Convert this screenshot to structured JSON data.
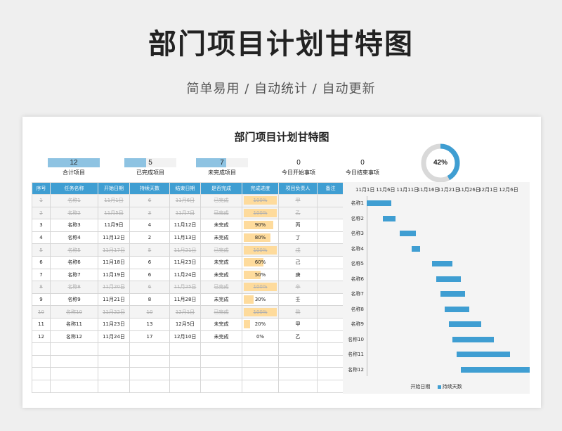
{
  "hero": {
    "title": "部门项目计划甘特图",
    "subtitle": "简单易用  /  自动统计  /  自动更新"
  },
  "sheet": {
    "title": "部门项目计划甘特图"
  },
  "stats": [
    {
      "value": "12",
      "label": "合计项目",
      "fill": 1.0
    },
    {
      "value": "5",
      "label": "已完成项目",
      "fill": 0.42
    },
    {
      "value": "7",
      "label": "未完成项目",
      "fill": 0.58
    },
    {
      "value": "0",
      "label": "今日开始事项",
      "fill": 0
    },
    {
      "value": "0",
      "label": "今日结束事项",
      "fill": 0
    }
  ],
  "donut": {
    "percent": "42%",
    "fraction": 0.42,
    "color": "#3f9ed2",
    "track": "#d9d9d9"
  },
  "table": {
    "headers": [
      "序号",
      "任务名称",
      "开始日期",
      "持续天数",
      "结束日期",
      "是否完成",
      "完成进度",
      "项目负责人",
      "备注"
    ],
    "rows": [
      {
        "no": "1",
        "name": "名称1",
        "start": "11月1日",
        "days": "6",
        "end": "11月6日",
        "status": "已完成",
        "progress": "100%",
        "p": 1.0,
        "owner": "甲",
        "done": true
      },
      {
        "no": "2",
        "name": "名称2",
        "start": "11月5日",
        "days": "3",
        "end": "11月7日",
        "status": "已完成",
        "progress": "100%",
        "p": 1.0,
        "owner": "乙",
        "done": true
      },
      {
        "no": "3",
        "name": "名称3",
        "start": "11月9日",
        "days": "4",
        "end": "11月12日",
        "status": "未完成",
        "progress": "90%",
        "p": 0.9,
        "owner": "丙",
        "done": false
      },
      {
        "no": "4",
        "name": "名称4",
        "start": "11月12日",
        "days": "2",
        "end": "11月13日",
        "status": "未完成",
        "progress": "80%",
        "p": 0.8,
        "owner": "丁",
        "done": false
      },
      {
        "no": "5",
        "name": "名称5",
        "start": "11月17日",
        "days": "5",
        "end": "11月21日",
        "status": "已完成",
        "progress": "100%",
        "p": 1.0,
        "owner": "戊",
        "done": true
      },
      {
        "no": "6",
        "name": "名称6",
        "start": "11月18日",
        "days": "6",
        "end": "11月23日",
        "status": "未完成",
        "progress": "60%",
        "p": 0.6,
        "owner": "己",
        "done": false
      },
      {
        "no": "7",
        "name": "名称7",
        "start": "11月19日",
        "days": "6",
        "end": "11月24日",
        "status": "未完成",
        "progress": "50%",
        "p": 0.5,
        "owner": "庚",
        "done": false
      },
      {
        "no": "8",
        "name": "名称8",
        "start": "11月20日",
        "days": "6",
        "end": "11月25日",
        "status": "已完成",
        "progress": "100%",
        "p": 1.0,
        "owner": "辛",
        "done": true
      },
      {
        "no": "9",
        "name": "名称9",
        "start": "11月21日",
        "days": "8",
        "end": "11月28日",
        "status": "未完成",
        "progress": "30%",
        "p": 0.3,
        "owner": "壬",
        "done": false
      },
      {
        "no": "10",
        "name": "名称10",
        "start": "11月22日",
        "days": "10",
        "end": "12月1日",
        "status": "已完成",
        "progress": "100%",
        "p": 1.0,
        "owner": "癸",
        "done": true
      },
      {
        "no": "11",
        "name": "名称11",
        "start": "11月23日",
        "days": "13",
        "end": "12月5日",
        "status": "未完成",
        "progress": "20%",
        "p": 0.2,
        "owner": "甲",
        "done": false
      },
      {
        "no": "12",
        "name": "名称12",
        "start": "11月24日",
        "days": "17",
        "end": "12月10日",
        "status": "未完成",
        "progress": "0%",
        "p": 0,
        "owner": "乙",
        "done": false
      }
    ],
    "empty_rows": 4
  },
  "chart_data": {
    "type": "bar",
    "orientation": "horizontal-stacked",
    "x_tick_labels": [
      "11月1日",
      "11月6日",
      "11月11日",
      "11月16日",
      "11月21日",
      "11月26日",
      "12月1日",
      "12月6日"
    ],
    "xlim": [
      "11月1日",
      "12月11日"
    ],
    "categories": [
      "名称1",
      "名称2",
      "名称3",
      "名称4",
      "名称5",
      "名称6",
      "名称7",
      "名称8",
      "名称9",
      "名称10",
      "名称11",
      "名称12"
    ],
    "series": [
      {
        "name": "开始日期",
        "values": [
          "11月1日",
          "11月5日",
          "11月9日",
          "11月12日",
          "11月17日",
          "11月18日",
          "11月19日",
          "11月20日",
          "11月21日",
          "11月22日",
          "11月23日",
          "11月24日"
        ],
        "visible": false
      },
      {
        "name": "持续天数",
        "values": [
          6,
          3,
          4,
          2,
          5,
          6,
          6,
          6,
          8,
          10,
          13,
          17
        ],
        "color": "#3f9ed2"
      }
    ],
    "legend": "bottom"
  }
}
